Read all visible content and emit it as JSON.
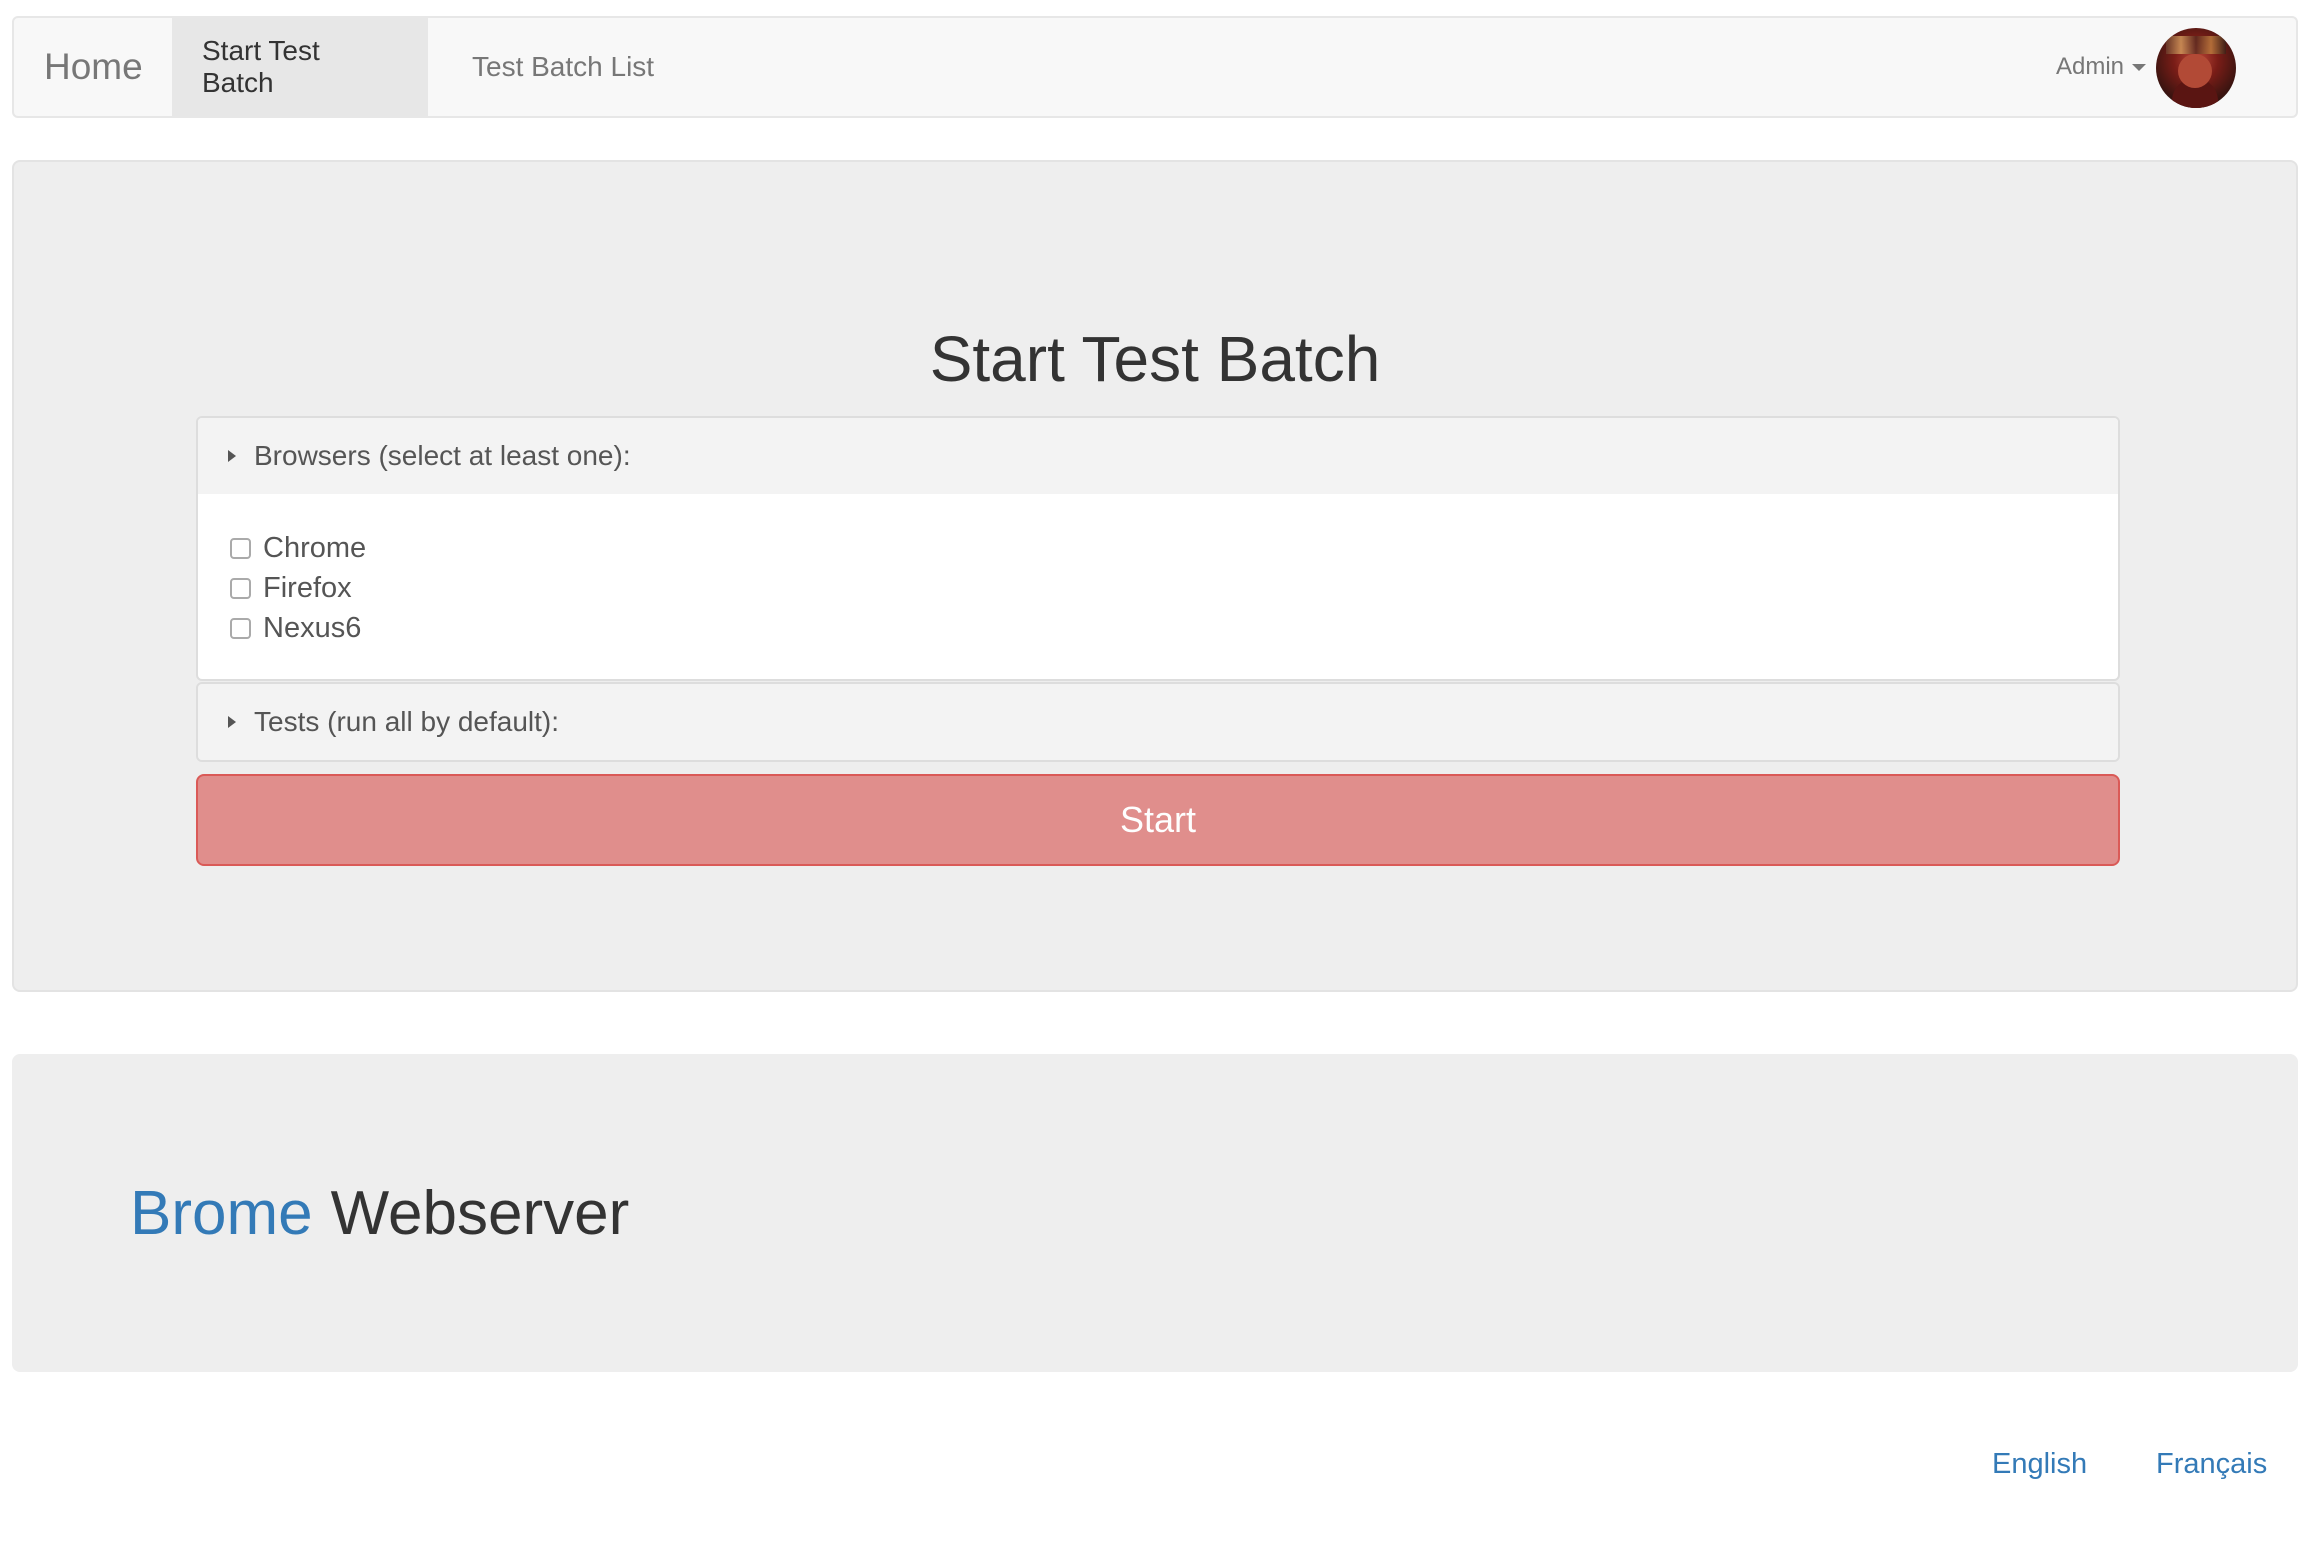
{
  "navbar": {
    "brand": "Home",
    "items": [
      {
        "label": "Start Test Batch",
        "active": true
      },
      {
        "label": "Test Batch List",
        "active": false
      }
    ],
    "user_menu": "Admin"
  },
  "main": {
    "title": "Start Test Batch",
    "browsers_panel": {
      "heading": "Browsers (select at least one):",
      "options": [
        {
          "label": "Chrome",
          "checked": false
        },
        {
          "label": "Firefox",
          "checked": false
        },
        {
          "label": "Nexus6",
          "checked": false
        }
      ]
    },
    "tests_panel": {
      "heading": "Tests (run all by default):"
    },
    "start_button": "Start"
  },
  "footer": {
    "brand_word": "Brome",
    "brand_rest": "Webserver",
    "languages": [
      "English",
      "Français"
    ]
  },
  "colors": {
    "link": "#337ab7",
    "start_button": "#e08987",
    "jumbotron": "#eeeeee"
  },
  "icons": [
    "caret-down-icon",
    "triangle-right-icon",
    "avatar"
  ]
}
